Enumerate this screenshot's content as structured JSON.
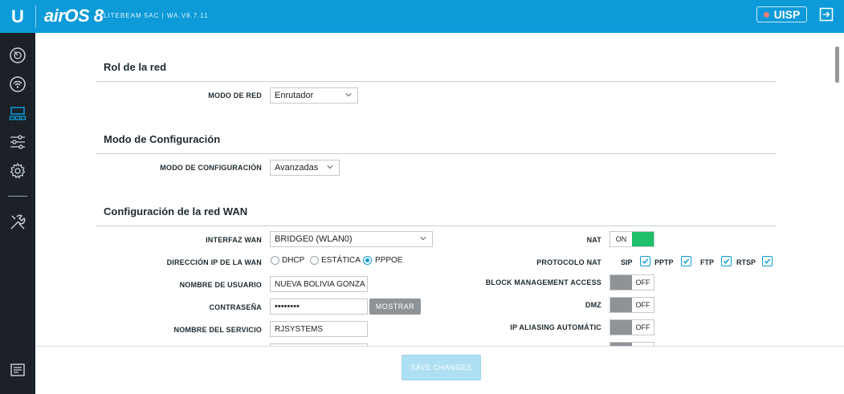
{
  "header": {
    "logo": "U",
    "brand": "airOS 8",
    "device": "LITEBEAM 5AC | WA.V8.7.11",
    "uisp_label": "UISP"
  },
  "sidebar": {
    "items": [
      {
        "icon": "gauge-icon"
      },
      {
        "icon": "wireless-icon"
      },
      {
        "icon": "network-icon"
      },
      {
        "icon": "sliders-icon"
      },
      {
        "icon": "gear-icon"
      },
      {
        "icon": "tools-icon"
      },
      {
        "icon": "log-icon"
      }
    ]
  },
  "sections": {
    "network_role": {
      "title": "Rol de la red",
      "mode_label": "MODO DE RED",
      "mode_value": "Enrutador"
    },
    "config_mode": {
      "title": "Modo de Configuración",
      "mode_label": "MODO DE CONFIGURACIÓN",
      "mode_value": "Avanzadas"
    },
    "wan": {
      "title": "Configuración de la red WAN",
      "interface_label": "INTERFAZ WAN",
      "interface_value": "BRIDGE0 (WLAN0)",
      "ip_label": "DIRECCIÓN IP DE LA WAN",
      "ip_options": [
        "DHCP",
        "ESTÁTICA",
        "PPPOE"
      ],
      "ip_selected": "PPPOE",
      "user_label": "NOMBRE DE USUARIO",
      "user_value": "NUEVA BOLIVIA GONZA",
      "password_label": "CONTRASEÑA",
      "password_value": "••••••••",
      "show_label": "MOSTRAR",
      "service_label": "NOMBRE DEL SERVICIO",
      "service_value": "RJSYSTEMS",
      "nat_label": "NAT",
      "nat_state": "ON",
      "nat_protocol_label": "PROTOCOLO NAT",
      "nat_protocols": [
        "SIP",
        "PPTP",
        "FTP",
        "RTSP"
      ],
      "block_mgmt_label": "BLOCK MANAGEMENT ACCESS",
      "block_mgmt_state": "OFF",
      "dmz_label": "DMZ",
      "dmz_state": "OFF",
      "ip_alias_label": "IP ALIASING AUTOMÁTIC",
      "ip_alias_state": "OFF"
    }
  },
  "footer": {
    "save_label": "SAVE CHANGES"
  },
  "colors": {
    "topbar": "#0c9ad8",
    "sidebar": "#1b2126",
    "toggle_on": "#1fbf6b",
    "toggle_off": "#8e9398",
    "save_button": "#aedff3"
  }
}
